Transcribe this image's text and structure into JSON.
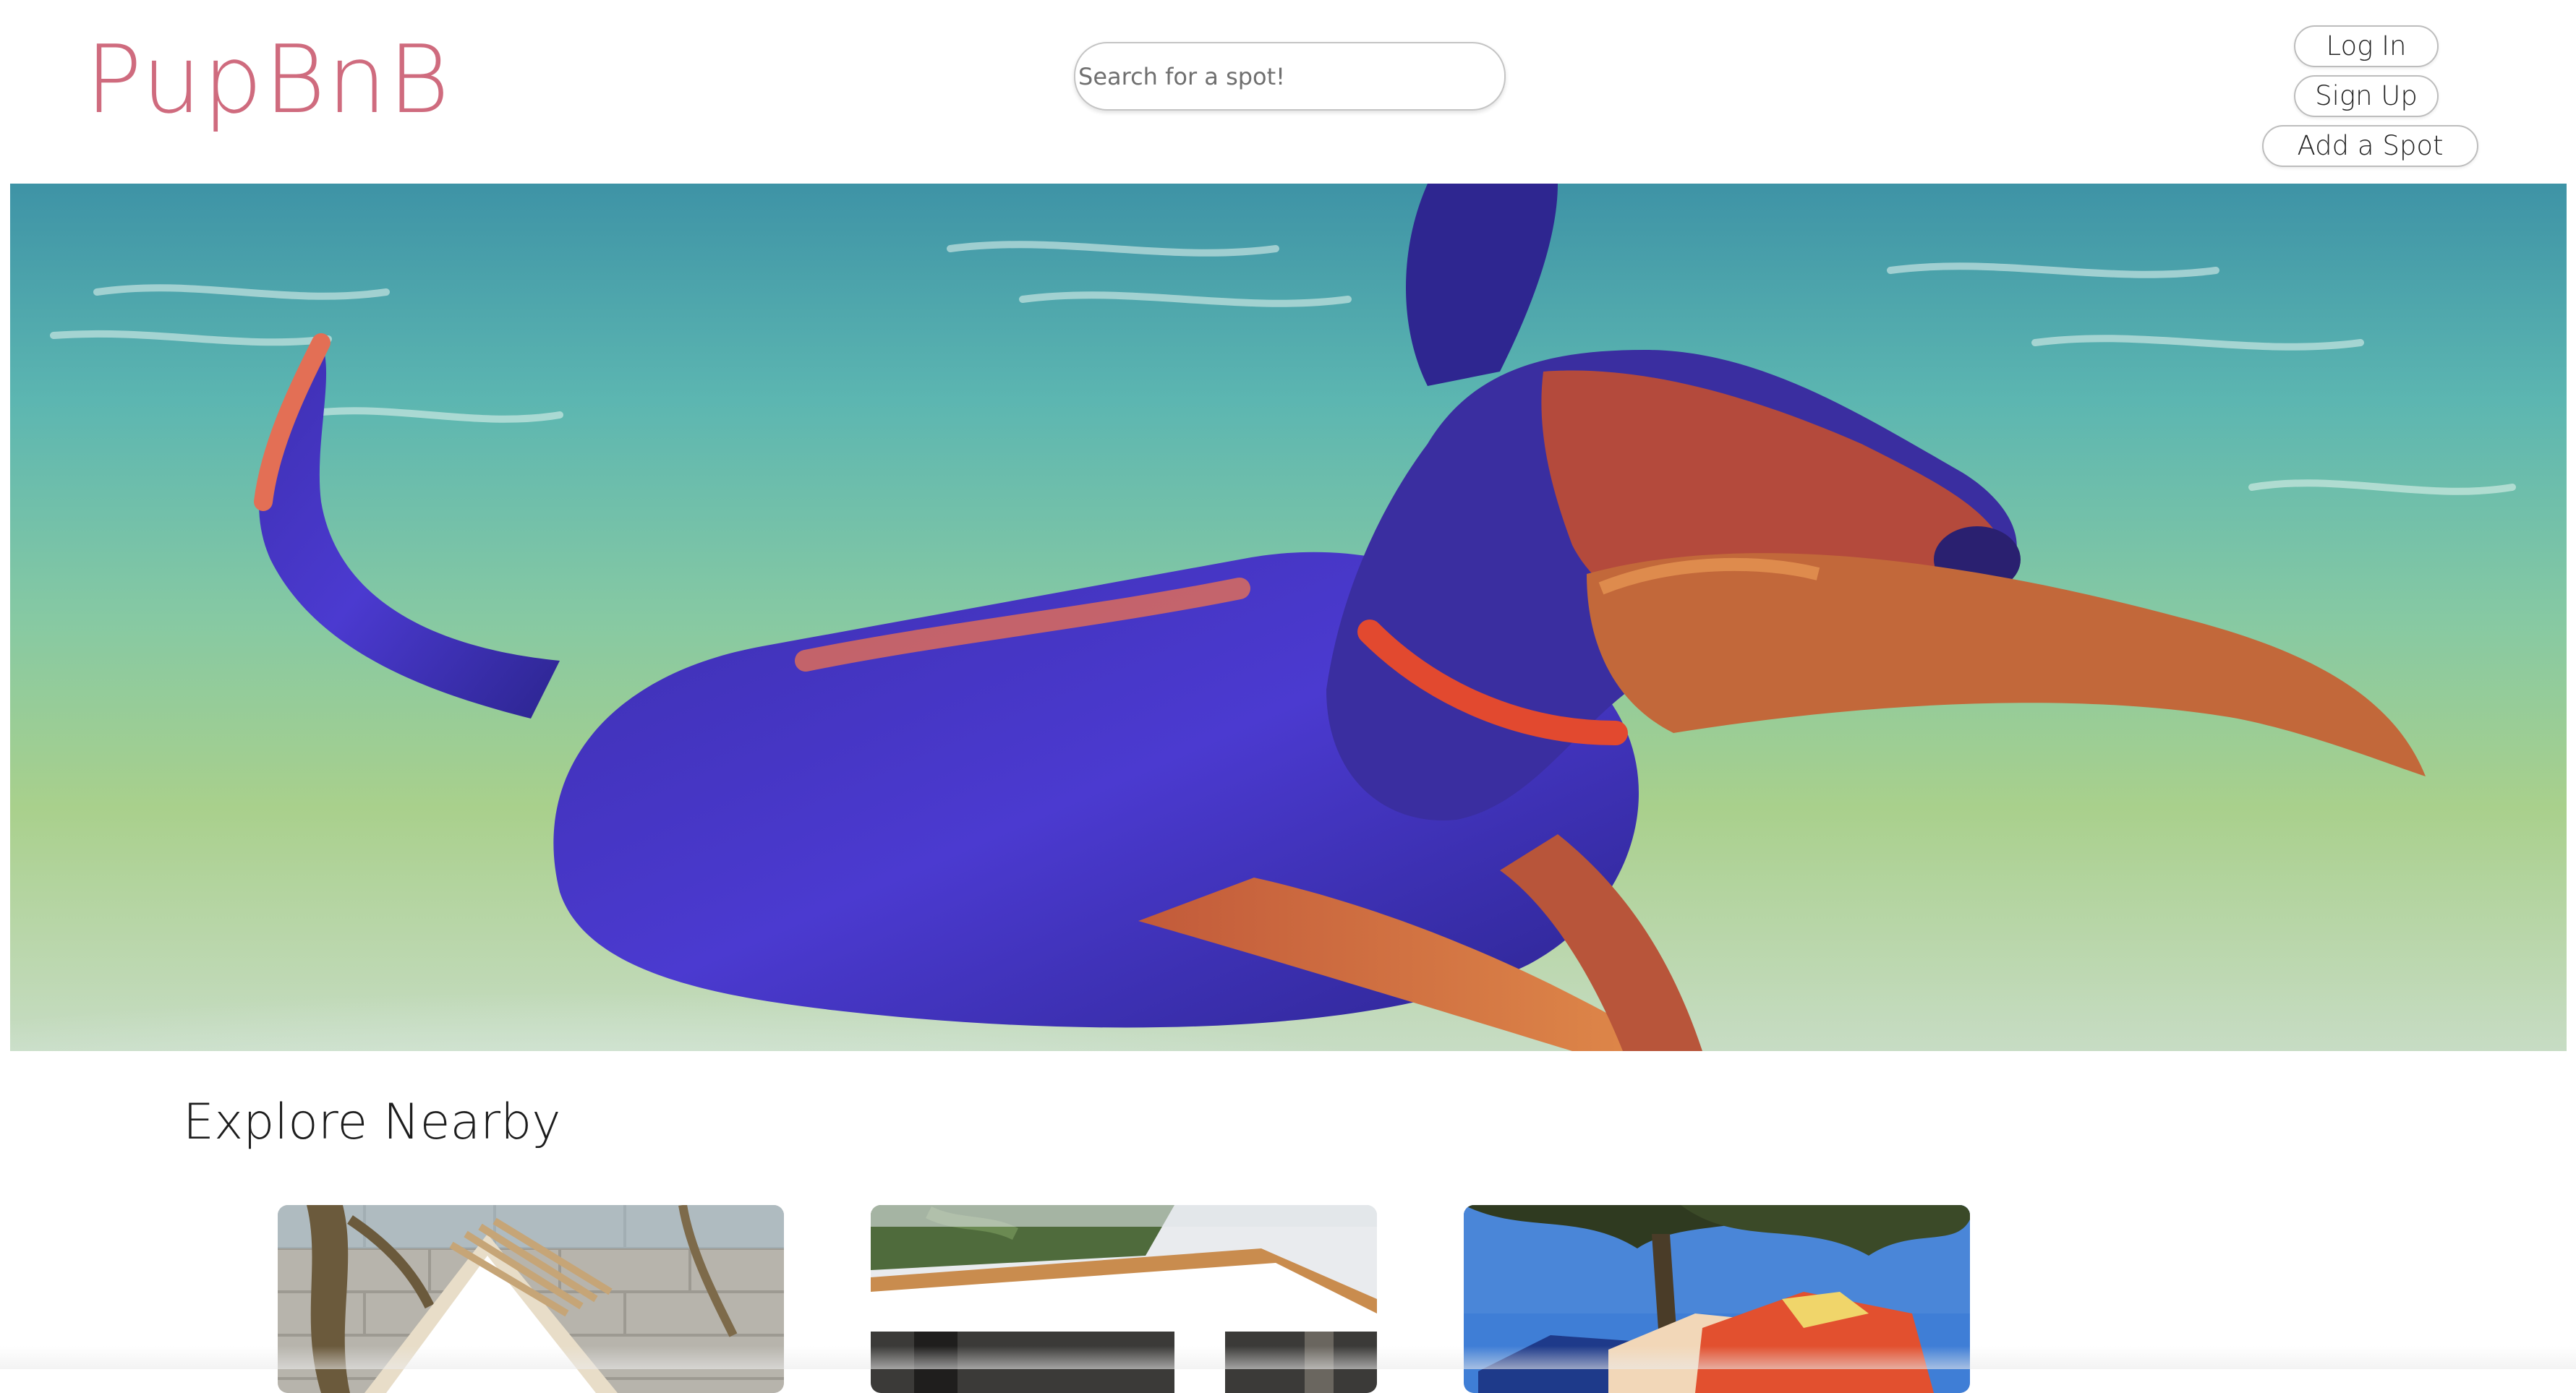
{
  "header": {
    "logo_text": "PupBnB",
    "brand_color": "#cf6b7e",
    "search": {
      "placeholder": "Search for a spot!",
      "value": ""
    },
    "nav": {
      "login_label": "Log In",
      "signup_label": "Sign Up",
      "add_spot_label": "Add a Spot"
    }
  },
  "hero": {
    "image": "painting-of-dog-running-through-water"
  },
  "explore": {
    "title": "Explore Nearby",
    "cards": [
      {
        "image": "wooden-a-frame-doghouse"
      },
      {
        "image": "modern-flat-roof-doghouse"
      },
      {
        "image": "colorful-geometric-doghouse"
      }
    ]
  }
}
